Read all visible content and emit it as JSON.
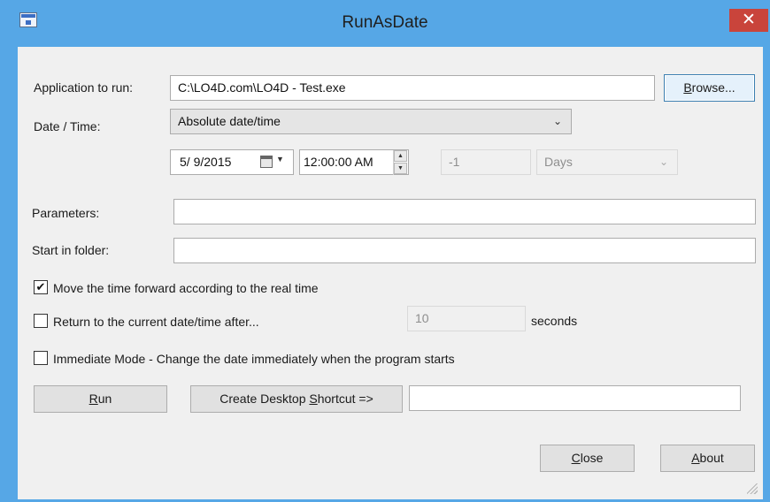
{
  "window": {
    "title": "RunAsDate",
    "close_glyph": "✕"
  },
  "app_to_run": {
    "label": "Application to run:",
    "value": "C:\\LO4D.com\\LO4D - Test.exe",
    "browse_prefix": "",
    "browse_accel": "B",
    "browse_rest": "rowse..."
  },
  "date_time": {
    "label": "Date / Time:",
    "mode_selected": "Absolute date/time",
    "date_value": "5/ 9/2015",
    "time_value": "12:00:00 AM",
    "offset_value": "-1",
    "offset_unit": "Days"
  },
  "parameters": {
    "label": "Parameters:",
    "value": ""
  },
  "start_in_folder": {
    "label": "Start in folder:",
    "value": ""
  },
  "options": {
    "move_forward": {
      "label": "Move the time forward according to the real time",
      "checked": true,
      "mark": "✔"
    },
    "return_after": {
      "label": "Return to the current date/time after...",
      "checked": false,
      "seconds_value": "10",
      "seconds_label": "seconds"
    },
    "immediate": {
      "label": "Immediate Mode - Change the date immediately when the program starts",
      "checked": false
    }
  },
  "actions": {
    "run_accel": "R",
    "run_rest": "un",
    "shortcut_prefix": "Create Desktop ",
    "shortcut_accel": "S",
    "shortcut_rest": "hortcut =>",
    "shortcut_name": "",
    "close_accel": "C",
    "close_rest": "lose",
    "about_accel": "A",
    "about_rest": "bout"
  },
  "icons": [
    "app-icon",
    "close-icon",
    "calendar-icon",
    "dropdown-arrow-icon",
    "spin-up-icon",
    "spin-down-icon",
    "chevron-down-icon",
    "checkmark-icon",
    "resize-grip-icon"
  ],
  "colors": {
    "titlebar": "#56a7e6",
    "close_button": "#c9443b",
    "dialog_bg": "#f0f0f0",
    "button_focus": "#3c7fb1"
  }
}
